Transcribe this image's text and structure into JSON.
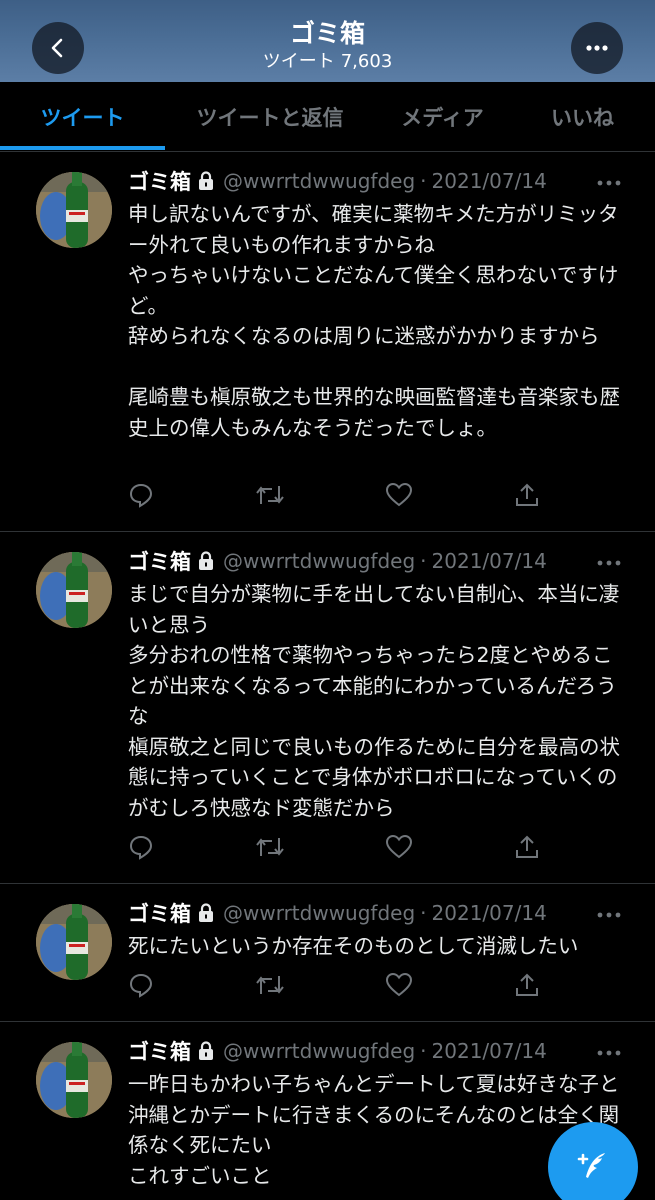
{
  "header": {
    "title": "ゴミ箱",
    "tweet_label": "ツイート",
    "tweet_count": "7,603"
  },
  "tabs": [
    {
      "label": "ツイート",
      "active": true
    },
    {
      "label": "ツイートと返信",
      "active": false
    },
    {
      "label": "メディア",
      "active": false
    },
    {
      "label": "いいね",
      "active": false
    }
  ],
  "tweets": [
    {
      "name": "ゴミ箱",
      "handle": "@wwrrtdwwugfdeg",
      "dot": "·",
      "date": "2021/07/14",
      "text": "申し訳ないんですが、確実に薬物キメた方がリミッター外れて良いもの作れますからね\nやっちゃいけないことだなんて僕全く思わないですけど。\n辞められなくなるのは周りに迷惑がかかりますから\n\n尾崎豊も槇原敬之も世界的な映画監督達も音楽家も歴史上の偉人もみんなそうだったでしょ。"
    },
    {
      "name": "ゴミ箱",
      "handle": "@wwrrtdwwugfdeg",
      "dot": "·",
      "date": "2021/07/14",
      "text": "まじで自分が薬物に手を出してない自制心、本当に凄いと思う\n多分おれの性格で薬物やっちゃったら2度とやめることが出来なくなるって本能的にわかっているんだろうな\n槇原敬之と同じで良いもの作るために自分を最高の状態に持っていくことで身体がボロボロになっていくのがむしろ快感なド変態だから"
    },
    {
      "name": "ゴミ箱",
      "handle": "@wwrrtdwwugfdeg",
      "dot": "·",
      "date": "2021/07/14",
      "text": "死にたいというか存在そのものとして消滅したい"
    },
    {
      "name": "ゴミ箱",
      "handle": "@wwrrtdwwugfdeg",
      "dot": "·",
      "date": "2021/07/14",
      "text": "一昨日もかわい子ちゃんとデートして夏は好きな子と沖縄とかデートに行きまくるのにそんなのとは全く関係なく死にたい\nこれすごいこと"
    }
  ],
  "icons": {
    "back": "arrow-left-icon",
    "more": "more-horizontal-icon",
    "lock": "lock-icon",
    "reply": "reply-icon",
    "retweet": "retweet-icon",
    "like": "heart-icon",
    "share": "share-icon",
    "compose": "compose-tweet-icon"
  },
  "colors": {
    "accent": "#1d9bf0",
    "background": "#000000",
    "secondary_text": "#71767b",
    "divider": "#2f3336"
  }
}
